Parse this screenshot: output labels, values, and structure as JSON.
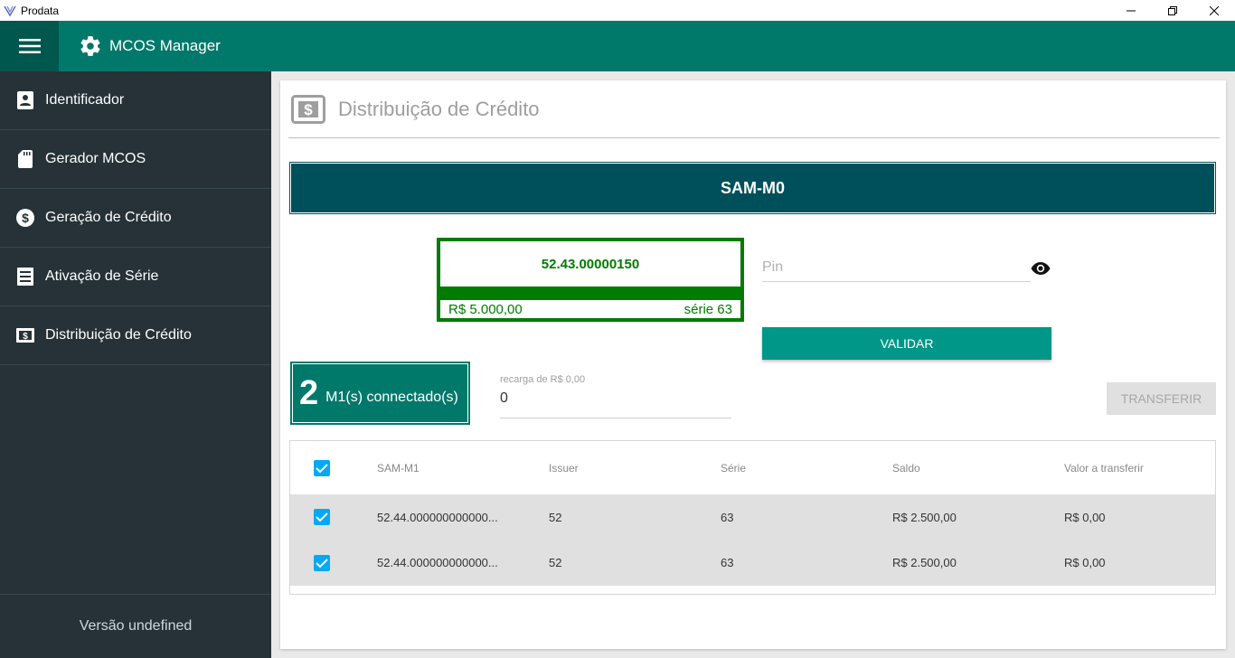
{
  "window": {
    "title": "Prodata"
  },
  "appbar": {
    "title": "MCOS Manager"
  },
  "sidebar": {
    "items": [
      {
        "label": "Identificador"
      },
      {
        "label": "Gerador MCOS"
      },
      {
        "label": "Geração de Crédito"
      },
      {
        "label": "Ativação de Série"
      },
      {
        "label": "Distribuição de Crédito"
      }
    ],
    "version": "Versão undefined"
  },
  "page": {
    "title": "Distribuição de Crédito"
  },
  "sam_m0": {
    "label": "SAM-M0",
    "id": "52.43.00000150",
    "balance": "R$ 5.000,00",
    "series": "série 63"
  },
  "pin": {
    "placeholder": "Pin",
    "value": ""
  },
  "buttons": {
    "validar": "VALIDAR",
    "transferir": "TRANSFERIR"
  },
  "m1": {
    "count": "2",
    "label": "M1(s) connectado(s)"
  },
  "recarga": {
    "label": "recarga de R$ 0,00",
    "value": "0"
  },
  "table": {
    "headers": [
      "SAM-M1",
      "Issuer",
      "Série",
      "Saldo",
      "Valor a transferir"
    ],
    "rows": [
      {
        "sam": "52.44.000000000000...",
        "issuer": "52",
        "serie": "63",
        "saldo": "R$ 2.500,00",
        "valor": "R$ 0,00",
        "checked": true
      },
      {
        "sam": "52.44.000000000000...",
        "issuer": "52",
        "serie": "63",
        "saldo": "R$ 2.500,00",
        "valor": "R$ 0,00",
        "checked": true
      }
    ]
  },
  "colors": {
    "appbar": "#00796b",
    "sidebar": "#263238",
    "accent": "#009688",
    "sam_green": "#007c00",
    "sam_m0_bg": "#00505c",
    "checkbox": "#03a9f4"
  }
}
